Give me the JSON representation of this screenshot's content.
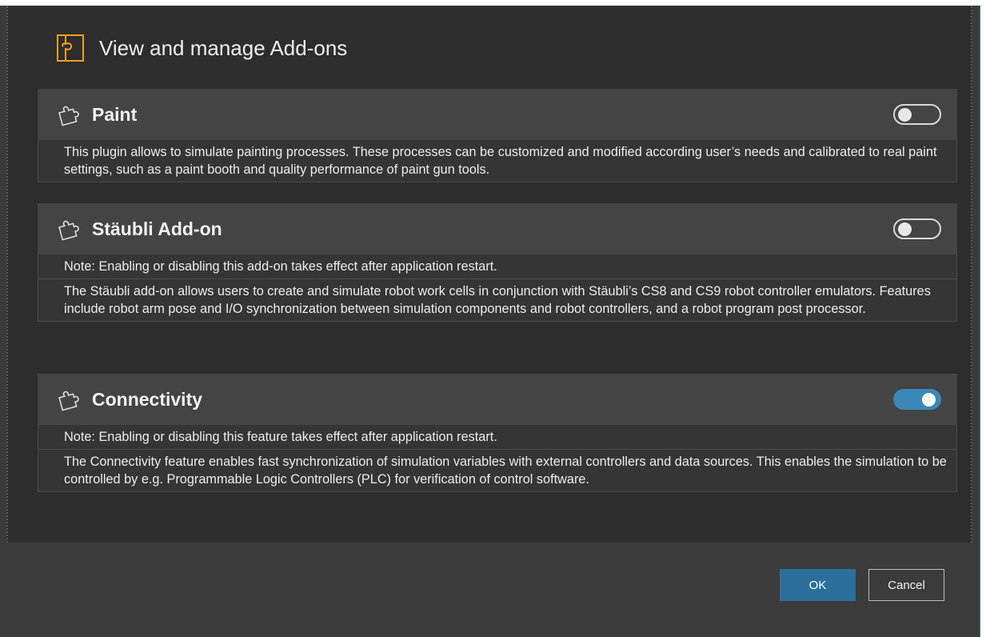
{
  "dialog": {
    "title": "View and manage Add-ons"
  },
  "addons": [
    {
      "name": "Paint",
      "enabled": false,
      "icon": "puzzle-icon",
      "description": "This plugin allows to simulate painting processes. These processes can be customized and modified according user’s needs and calibrated to real paint settings, such as a paint booth and quality performance of paint gun tools."
    },
    {
      "name": "Stäubli Add-on",
      "enabled": false,
      "icon": "puzzle-icon",
      "note": "Note: Enabling or disabling this add-on takes effect after application restart.",
      "description": "The Stäubli add-on allows users to create and simulate robot work cells in conjunction with Stäubli’s CS8 and CS9 robot controller emulators. Features include robot arm pose and I/O synchronization between simulation components and robot controllers, and a robot program post processor."
    },
    {
      "name": "Connectivity",
      "enabled": true,
      "icon": "puzzle-icon",
      "note": "Note: Enabling or disabling this feature takes effect after application restart.",
      "description": "The Connectivity feature enables fast synchronization of simulation variables with external controllers and data sources. This enables the simulation to be controlled by e.g. Programmable Logic Controllers (PLC) for verification of control software."
    }
  ],
  "footer": {
    "ok_label": "OK",
    "cancel_label": "Cancel"
  },
  "colors": {
    "accent": "#2a6f99",
    "logo": "#f0a21c"
  }
}
